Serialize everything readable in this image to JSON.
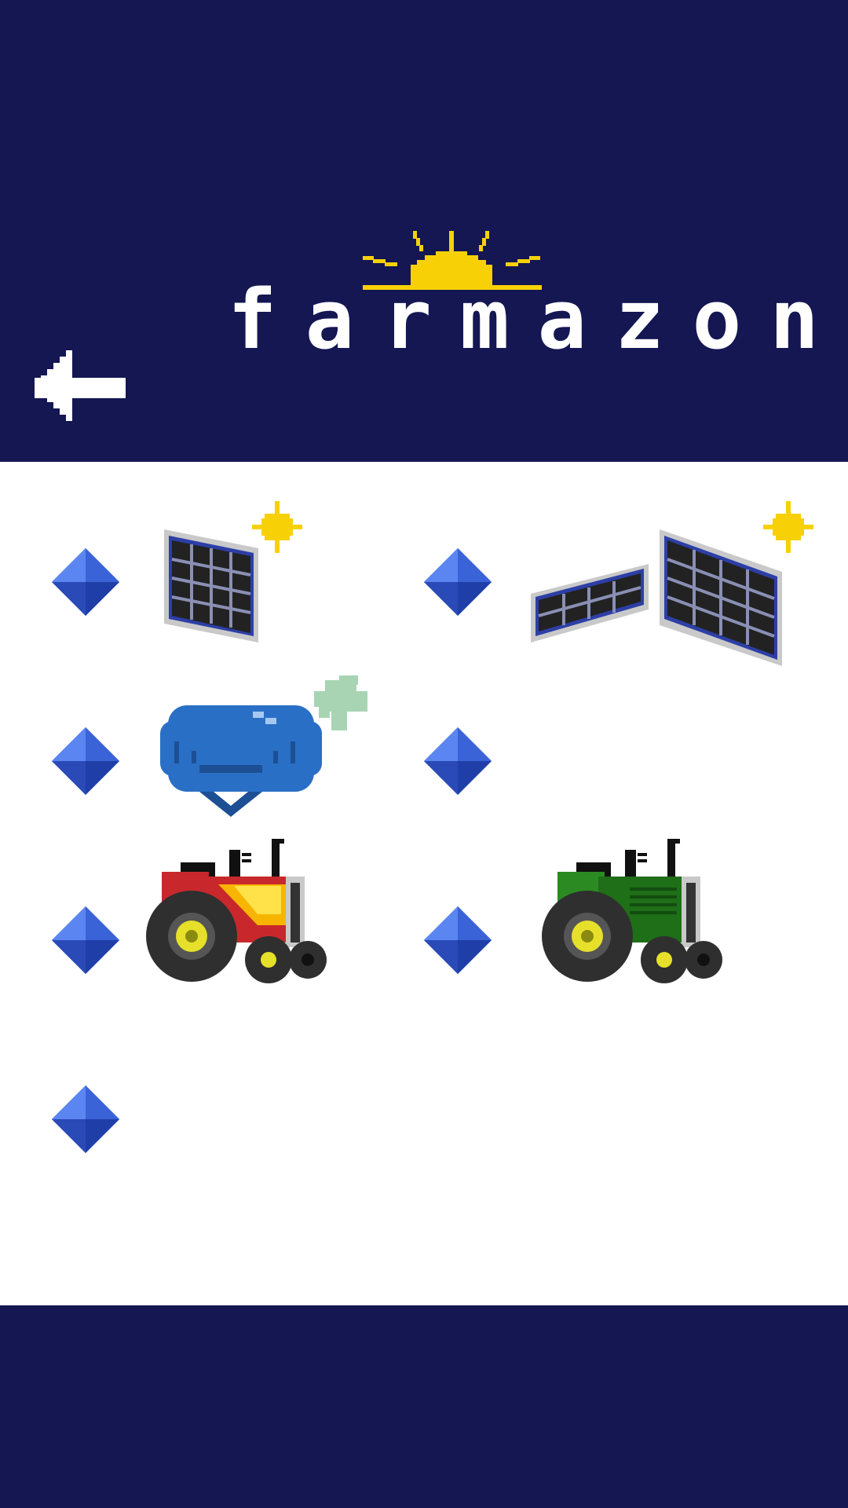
{
  "app": {
    "title": "farmazon",
    "colors": {
      "header_bg": "#141752",
      "content_bg": "#ffffff",
      "sun": "#f7d106",
      "gem_light": "#5b86f2",
      "gem_dark": "#1f3ea8"
    }
  },
  "header": {
    "logo_text": "farmazon",
    "logo_icon": "rising-sun-icon",
    "back_icon": "back-arrow-icon"
  },
  "shop": {
    "items": [
      {
        "id": "solar-panel-small",
        "icon": "solar-panel-icon",
        "price_icon": "blue-gem-icon"
      },
      {
        "id": "solar-panel-large",
        "icon": "solar-panel-double-icon",
        "price_icon": "blue-gem-icon"
      },
      {
        "id": "blue-water-tank",
        "icon": "water-tank-icon",
        "price_icon": "blue-gem-icon"
      },
      {
        "id": "empty-slot",
        "icon": "",
        "price_icon": "blue-gem-icon"
      },
      {
        "id": "red-tractor",
        "icon": "red-tractor-icon",
        "price_icon": "blue-gem-icon"
      },
      {
        "id": "green-tractor",
        "icon": "green-tractor-icon",
        "price_icon": "blue-gem-icon"
      },
      {
        "id": "empty-slot-2",
        "icon": "",
        "price_icon": "blue-gem-icon"
      }
    ]
  }
}
